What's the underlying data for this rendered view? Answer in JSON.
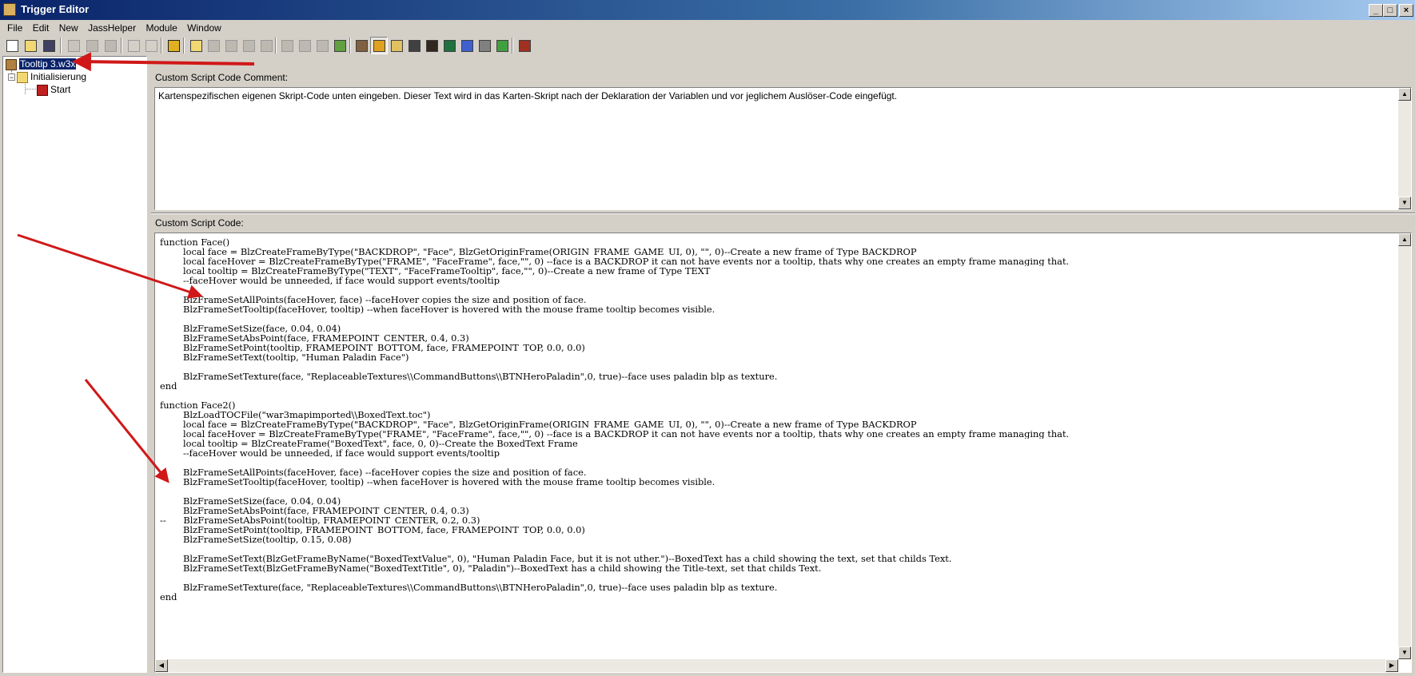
{
  "window": {
    "title": "Trigger Editor"
  },
  "menu": [
    "File",
    "Edit",
    "New",
    "JassHelper",
    "Module",
    "Window"
  ],
  "toolbar_icons": [
    "new-icon",
    "open-icon",
    "save-icon",
    "cut-icon",
    "copy-icon",
    "paste-icon",
    "undo-icon",
    "redo-icon",
    "jasshelper-icon",
    "new-category-icon",
    "new-trigger-icon",
    "new-comment-icon",
    "new-event-icon",
    "delete-icon",
    "test-map-icon",
    "new-condition-icon",
    "new-action-icon",
    "checklist-icon",
    "terrain-editor-icon",
    "trigger-editor-icon",
    "sound-editor-icon",
    "object-editor-icon",
    "campaign-editor-icon",
    "ai-editor-icon",
    "object-manager-icon",
    "import-manager-icon",
    "module-icon",
    "import-icon",
    "test-icon"
  ],
  "tree": {
    "root": "Tooltip 3.w3x",
    "folder": "Initialisierung",
    "trigger": "Start",
    "folder_expander": "−"
  },
  "comment": {
    "label": "Custom Script Code Comment:",
    "text": "Kartenspezifischen eigenen Skript-Code unten eingeben. Dieser Text wird in das Karten-Skript nach der Deklaration der Variablen und vor jeglichem Auslöser-Code eingefügt."
  },
  "code": {
    "label": "Custom Script Code:",
    "lines": [
      "function Face()",
      "        local face = BlzCreateFrameByType(\"BACKDROP\", \"Face\", BlzGetOriginFrame(ORIGIN_FRAME_GAME_UI, 0), \"\", 0)--Create a new frame of Type BACKDROP",
      "        local faceHover = BlzCreateFrameByType(\"FRAME\", \"FaceFrame\", face,\"\", 0) --face is a BACKDROP it can not have events nor a tooltip, thats why one creates an empty frame managing that.",
      "        local tooltip = BlzCreateFrameByType(\"TEXT\", \"FaceFrameTooltip\", face,\"\", 0)--Create a new frame of Type TEXT",
      "        --faceHover would be unneeded, if face would support events/tooltip",
      "",
      "        BlzFrameSetAllPoints(faceHover, face) --faceHover copies the size and position of face.",
      "        BlzFrameSetTooltip(faceHover, tooltip) --when faceHover is hovered with the mouse frame tooltip becomes visible.",
      "",
      "        BlzFrameSetSize(face, 0.04, 0.04)",
      "        BlzFrameSetAbsPoint(face, FRAMEPOINT_CENTER, 0.4, 0.3)",
      "        BlzFrameSetPoint(tooltip, FRAMEPOINT_BOTTOM, face, FRAMEPOINT_TOP, 0.0, 0.0)",
      "        BlzFrameSetText(tooltip, \"Human Paladin Face\")",
      "",
      "        BlzFrameSetTexture(face, \"ReplaceableTextures\\\\CommandButtons\\\\BTNHeroPaladin\",0, true)--face uses paladin blp as texture.",
      "end",
      "",
      "function Face2()",
      "        BlzLoadTOCFile(\"war3mapimported\\\\BoxedText.toc\")",
      "        local face = BlzCreateFrameByType(\"BACKDROP\", \"Face\", BlzGetOriginFrame(ORIGIN_FRAME_GAME_UI, 0), \"\", 0)--Create a new frame of Type BACKDROP",
      "        local faceHover = BlzCreateFrameByType(\"FRAME\", \"FaceFrame\", face,\"\", 0) --face is a BACKDROP it can not have events nor a tooltip, thats why one creates an empty frame managing that.",
      "        local tooltip = BlzCreateFrame(\"BoxedText\", face, 0, 0)--Create the BoxedText Frame",
      "        --faceHover would be unneeded, if face would support events/tooltip",
      "",
      "        BlzFrameSetAllPoints(faceHover, face) --faceHover copies the size and position of face.",
      "        BlzFrameSetTooltip(faceHover, tooltip) --when faceHover is hovered with the mouse frame tooltip becomes visible.",
      "",
      "        BlzFrameSetSize(face, 0.04, 0.04)",
      "        BlzFrameSetAbsPoint(face, FRAMEPOINT_CENTER, 0.4, 0.3)",
      "--      BlzFrameSetAbsPoint(tooltip, FRAMEPOINT_CENTER, 0.2, 0.3)",
      "        BlzFrameSetPoint(tooltip, FRAMEPOINT_BOTTOM, face, FRAMEPOINT_TOP, 0.0, 0.0)",
      "        BlzFrameSetSize(tooltip, 0.15, 0.08)",
      "",
      "        BlzFrameSetText(BlzGetFrameByName(\"BoxedTextValue\", 0), \"Human Paladin Face, but it is not uther.\")--BoxedText has a child showing the text, set that childs Text.",
      "        BlzFrameSetText(BlzGetFrameByName(\"BoxedTextTitle\", 0), \"Paladin\")--BoxedText has a child showing the Title-text, set that childs Text.",
      "",
      "        BlzFrameSetTexture(face, \"ReplaceableTextures\\\\CommandButtons\\\\BTNHeroPaladin\",0, true)--face uses paladin blp as texture.",
      "end"
    ]
  },
  "colors": {
    "title_start": "#0a246a",
    "title_end": "#a6caf0",
    "arrow": "#d01818"
  }
}
